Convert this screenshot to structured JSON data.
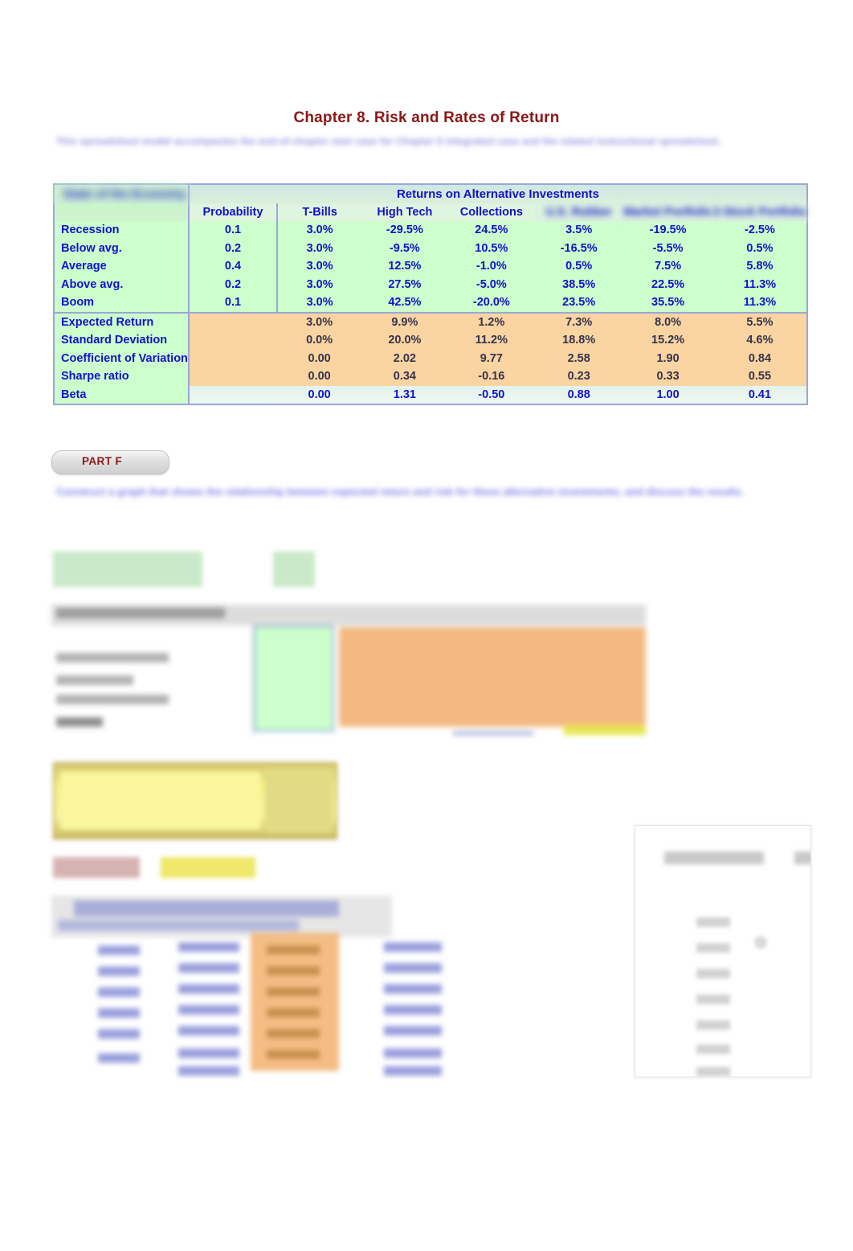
{
  "document": {
    "title": "Chapter 8.   Risk and Rates of Return",
    "title_color": "#8c1717",
    "intro_paragraph": "This spreadsheet model accompanies the end-of-chapter mini case for Chapter 8 integrated case and the related instructional spreadsheet."
  },
  "main_table": {
    "banner": "Returns on Alternative Investments",
    "corner_label": "State of the Economy",
    "headers": [
      "Probability",
      "T-Bills",
      "High Tech",
      "Collections",
      "U.S. Rubber",
      "Market Portfolio",
      "2-Stock Portfolio"
    ],
    "state_rows": [
      {
        "state": "Recession",
        "probability": "0.1",
        "tbills": "3.0%",
        "hightech": "-29.5%",
        "collections": "24.5%",
        "rubber": "3.5%",
        "market": "-19.5%",
        "portfolio": "-2.5%"
      },
      {
        "state": "Below avg.",
        "probability": "0.2",
        "tbills": "3.0%",
        "hightech": "-9.5%",
        "collections": "10.5%",
        "rubber": "-16.5%",
        "market": "-5.5%",
        "portfolio": "0.5%"
      },
      {
        "state": "Average",
        "probability": "0.4",
        "tbills": "3.0%",
        "hightech": "12.5%",
        "collections": "-1.0%",
        "rubber": "0.5%",
        "market": "7.5%",
        "portfolio": "5.8%"
      },
      {
        "state": "Above avg.",
        "probability": "0.2",
        "tbills": "3.0%",
        "hightech": "27.5%",
        "collections": "-5.0%",
        "rubber": "38.5%",
        "market": "22.5%",
        "portfolio": "11.3%"
      },
      {
        "state": "Boom",
        "probability": "0.1",
        "tbills": "3.0%",
        "hightech": "42.5%",
        "collections": "-20.0%",
        "rubber": "23.5%",
        "market": "35.5%",
        "portfolio": "11.3%"
      }
    ],
    "stat_rows": [
      {
        "label": "Expected Return",
        "probability": "",
        "tbills": "3.0%",
        "hightech": "9.9%",
        "collections": "1.2%",
        "rubber": "7.3%",
        "market": "8.0%",
        "portfolio": "5.5%"
      },
      {
        "label": "Standard Deviation",
        "probability": "",
        "tbills": "0.0%",
        "hightech": "20.0%",
        "collections": "11.2%",
        "rubber": "18.8%",
        "market": "15.2%",
        "portfolio": "4.6%"
      },
      {
        "label": "Coefficient of Variation",
        "probability": "",
        "tbills": "0.00",
        "hightech": "2.02",
        "collections": "9.77",
        "rubber": "2.58",
        "market": "1.90",
        "portfolio": "0.84"
      },
      {
        "label": "Sharpe ratio",
        "probability": "",
        "tbills": "0.00",
        "hightech": "0.34",
        "collections": "-0.16",
        "rubber": "0.23",
        "market": "0.33",
        "portfolio": "0.55"
      }
    ],
    "beta_row": {
      "label": "Beta",
      "probability": "",
      "tbills": "0.00",
      "hightech": "1.31",
      "collections": "-0.50",
      "rubber": "0.88",
      "market": "1.00",
      "portfolio": "0.41"
    },
    "colors": {
      "green_fill": "#ccffcc",
      "orange_fill": "#fad4a1",
      "border": "#9aa7d8",
      "text_blue": "#1111cc"
    }
  },
  "part_f": {
    "label": "PART F",
    "question": "Construct a graph that shows the relationship between expected return and risk for these alternative investments, and discuss the results."
  },
  "mid_block": {
    "heading": "Risk and return statistics by state",
    "rows": [
      "Recession",
      "Below average",
      "Average",
      "Above average",
      "Boom"
    ]
  },
  "bottom_block": {
    "heading": "Beta coefficients and required returns",
    "columns": [
      "Year",
      "Expected return",
      "Std. dev.",
      "Required return"
    ]
  },
  "right_panel": {
    "title": "Expected return",
    "badge": "8%"
  }
}
